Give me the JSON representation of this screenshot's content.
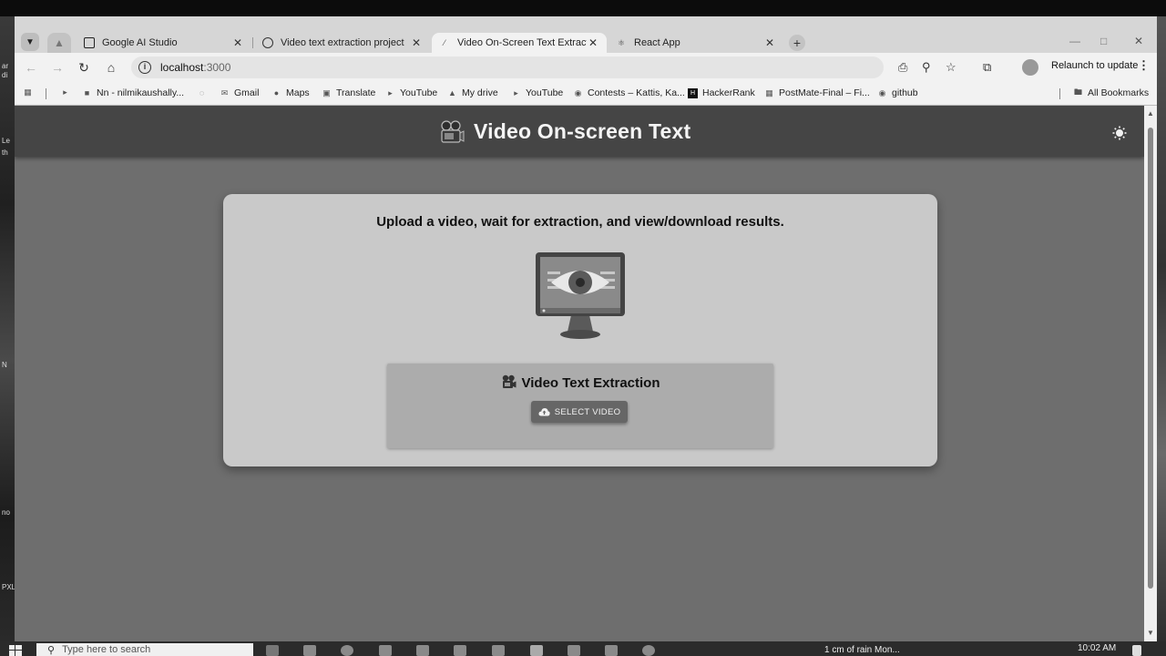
{
  "desktop": {
    "left_fragments": [
      "ar",
      "di",
      "Le",
      "th",
      "N",
      "no",
      "PXL"
    ]
  },
  "browser": {
    "tabs": [
      {
        "title": "Google AI Studio",
        "active": false
      },
      {
        "title": "Video text extraction project",
        "active": false
      },
      {
        "title": "Video On-Screen Text Extraction",
        "active": true
      },
      {
        "title": "React App",
        "active": false
      }
    ],
    "url_host": "localhost",
    "url_port": ":3000",
    "relaunch_label": "Relaunch to update",
    "bookmarks": [
      "Nn - nilmikaushally...",
      "Gmail",
      "Maps",
      "Translate",
      "YouTube",
      "My drive",
      "YouTube",
      "Contests – Kattis, Ka...",
      "HackerRank",
      "PostMate-Final – Fi...",
      "github"
    ],
    "all_bookmarks_label": "All Bookmarks"
  },
  "app": {
    "title": "Video On-screen Text",
    "subtitle": "Upload a video, wait for extraction, and view/download results.",
    "panel_title": "Video Text Extraction",
    "select_button": "SELECT VIDEO"
  },
  "taskbar": {
    "search_placeholder": "Type here to search",
    "weather": "1 cm of rain Mon...",
    "time": "10:02 AM"
  },
  "colors": {
    "appbar": "#454545",
    "page_bg": "#6e6e6e",
    "card_bg": "#c9c9c9",
    "panel_bg": "#acacac",
    "button_bg": "#666666"
  }
}
